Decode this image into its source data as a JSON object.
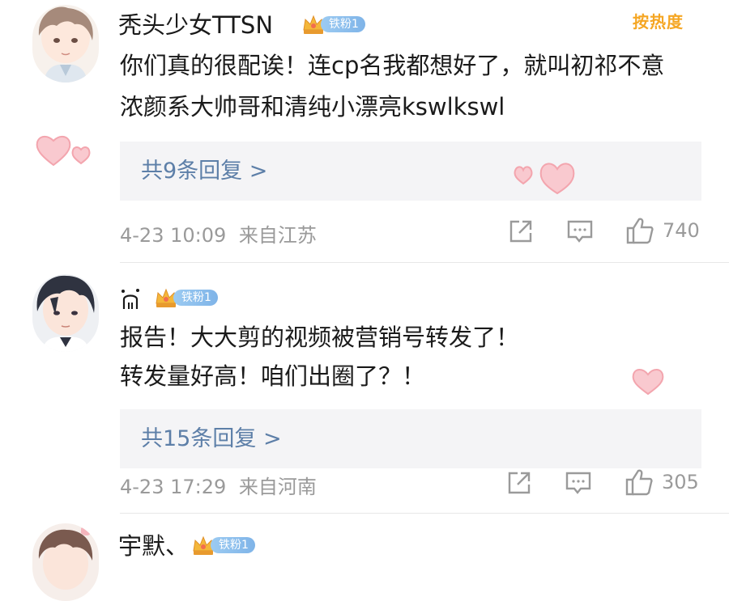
{
  "sort_label": "按热度",
  "badge_label": "铁粉1",
  "comments": [
    {
      "username": "秃头少女TTSN",
      "lines": [
        "你们真的很配诶！连cp名我都想好了，就叫初祁不意",
        "浓颜系大帅哥和清纯小漂亮kswlkswl"
      ],
      "replies": "共9条回复 >",
      "time": "4-23 10:09",
      "location": "来自江苏",
      "likes": "740"
    },
    {
      "username": "",
      "lines": [
        "报告！大大剪的视频被营销号转发了！",
        "转发量好高！咱们出圈了？！"
      ],
      "replies": "共15条回复 >",
      "time": "4-23 17:29",
      "location": "来自河南",
      "likes": "305"
    },
    {
      "username": "宇默、",
      "lines": []
    }
  ],
  "icons": {
    "share": "share-icon",
    "comment": "comment-icon",
    "like": "thumbs-up-icon",
    "heart": "heart-icon",
    "crown": "crown-badge-icon"
  },
  "colors": {
    "reply_link": "#5d7fa8",
    "sort_label": "#f5a623",
    "meta": "#9a9a9a",
    "badge": "#8dbfee",
    "heart": "#f2a8b0"
  }
}
